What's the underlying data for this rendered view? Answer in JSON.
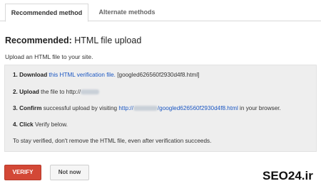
{
  "tabs": [
    {
      "label": "Recommended method",
      "active": true
    },
    {
      "label": "Alternate methods",
      "active": false
    }
  ],
  "heading": {
    "prefix": "Recommended:",
    "text": " HTML file upload"
  },
  "intro": "Upload an HTML file to your site.",
  "steps": {
    "s1": {
      "num": "1.",
      "bold": "Download",
      "link": "this HTML verification file.",
      "tail": " [googled626560f2930d4f8.html]"
    },
    "s2": {
      "num": "2.",
      "bold": "Upload",
      "text": " the file to http://"
    },
    "s3": {
      "num": "3.",
      "bold": "Confirm",
      "text": " successful upload by visiting ",
      "link_prefix": "http://",
      "link_suffix": "/googled626560f2930d4f8.html",
      "tail": " in your browser."
    },
    "s4": {
      "num": "4.",
      "bold": "Click",
      "text": " Verify below."
    }
  },
  "note": "To stay verified, don't remove the HTML file, even after verification succeeds.",
  "buttons": {
    "verify": "VERIFY",
    "not_now": "Not now"
  },
  "watermark": "SEO24.ir",
  "colors": {
    "link": "#1a56c2",
    "verify_button": "#d34836",
    "panel_bg": "#eeeeee"
  }
}
